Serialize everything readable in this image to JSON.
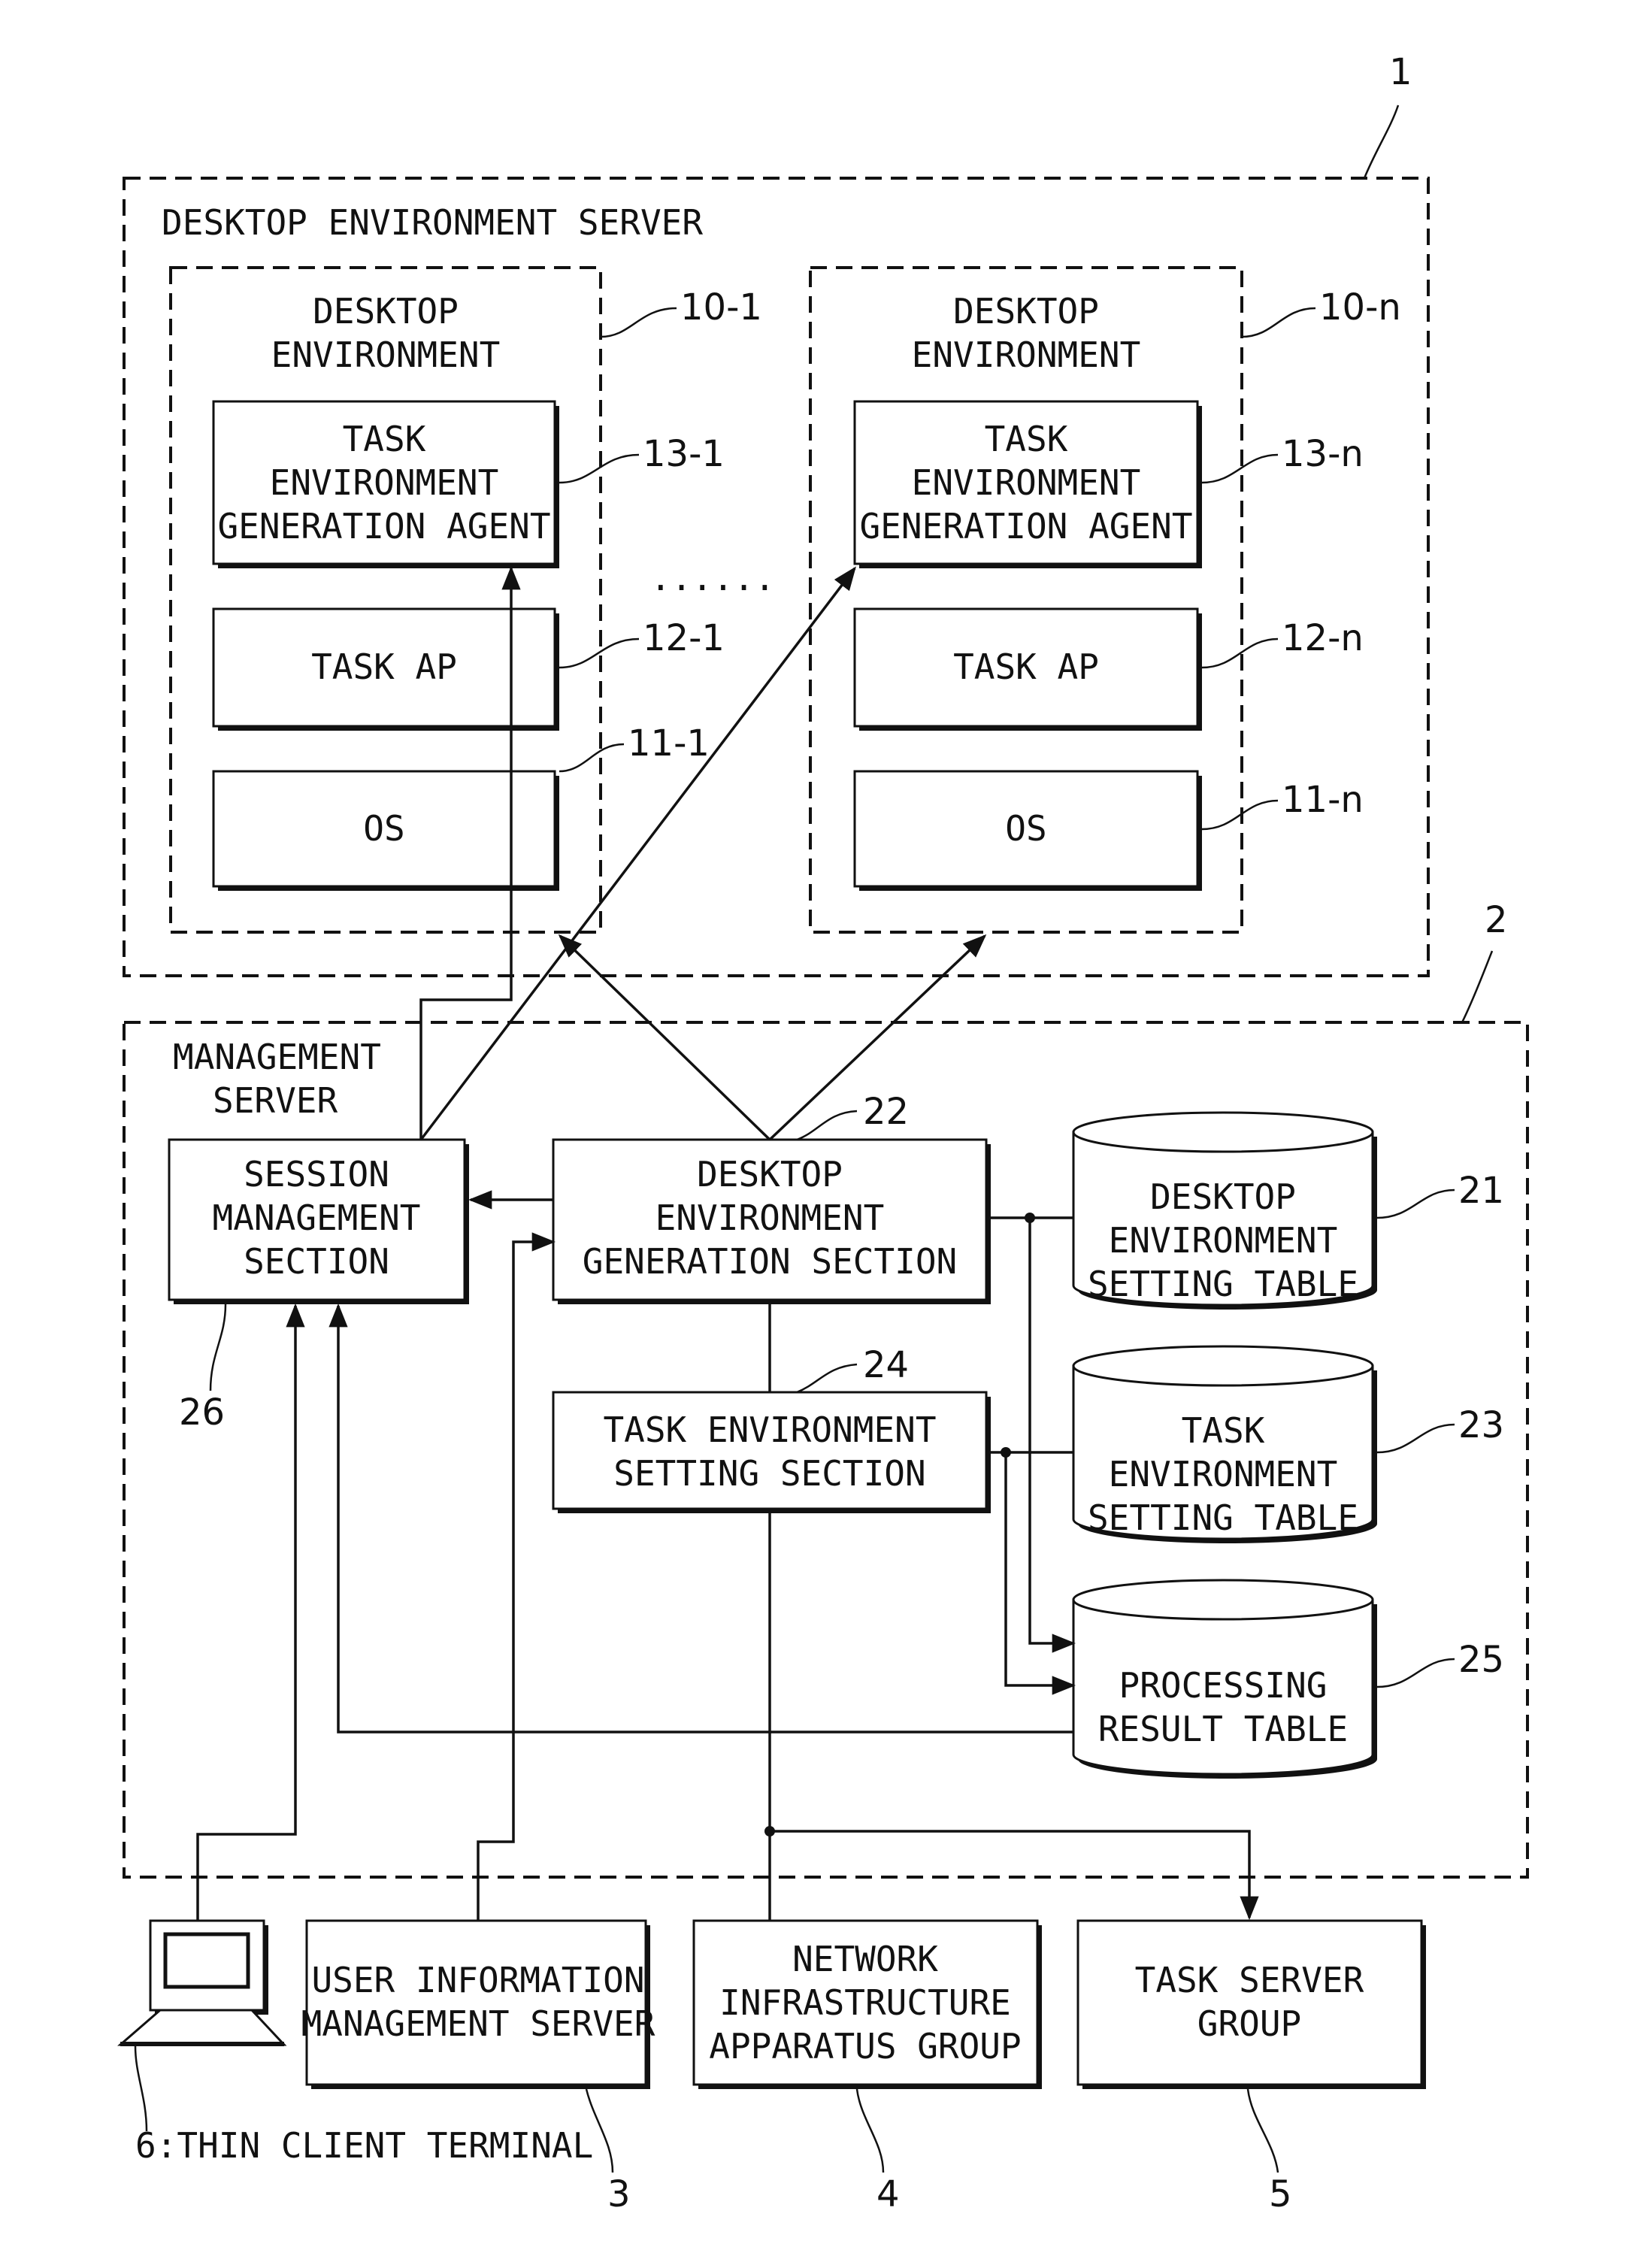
{
  "diagram": {
    "desktop_environment_server": {
      "title": "DESKTOP ENVIRONMENT SERVER",
      "ref": "1"
    },
    "desktop_environments": [
      {
        "title_line1": "DESKTOP",
        "title_line2": "ENVIRONMENT",
        "ref": "10-1",
        "agent": {
          "line1": "TASK",
          "line2": "ENVIRONMENT",
          "line3": "GENERATION AGENT",
          "ref": "13-1"
        },
        "task_ap": {
          "label": "TASK AP",
          "ref": "12-1"
        },
        "os": {
          "label": "OS",
          "ref": "11-1"
        }
      },
      {
        "title_line1": "DESKTOP",
        "title_line2": "ENVIRONMENT",
        "ref": "10-n",
        "agent": {
          "line1": "TASK",
          "line2": "ENVIRONMENT",
          "line3": "GENERATION AGENT",
          "ref": "13-n"
        },
        "task_ap": {
          "label": "TASK AP",
          "ref": "12-n"
        },
        "os": {
          "label": "OS",
          "ref": "11-n"
        }
      }
    ],
    "ellipsis": "......",
    "management_server": {
      "title_line1": "MANAGEMENT",
      "title_line2": "SERVER",
      "ref": "2",
      "session_management": {
        "line1": "SESSION",
        "line2": "MANAGEMENT",
        "line3": "SECTION",
        "ref": "26"
      },
      "desktop_env_generation": {
        "line1": "DESKTOP",
        "line2": "ENVIRONMENT",
        "line3": "GENERATION SECTION",
        "ref": "22"
      },
      "task_env_setting": {
        "line1": "TASK ENVIRONMENT",
        "line2": "SETTING SECTION",
        "ref": "24"
      },
      "desktop_env_setting_table": {
        "line1": "DESKTOP",
        "line2": "ENVIRONMENT",
        "line3": "SETTING TABLE",
        "ref": "21"
      },
      "task_env_setting_table": {
        "line1": "TASK",
        "line2": "ENVIRONMENT",
        "line3": "SETTING TABLE",
        "ref": "23"
      },
      "processing_result_table": {
        "line1": "PROCESSING",
        "line2": "RESULT TABLE",
        "ref": "25"
      }
    },
    "external": {
      "thin_client": {
        "label": "6:THIN CLIENT TERMINAL",
        "icon": "computer-terminal-icon"
      },
      "user_info_server": {
        "line1": "USER INFORMATION",
        "line2": "MANAGEMENT SERVER",
        "ref": "3"
      },
      "network_infra": {
        "line1": "NETWORK",
        "line2": "INFRASTRUCTURE",
        "line3": "APPARATUS GROUP",
        "ref": "4"
      },
      "task_server_group": {
        "line1": "TASK SERVER",
        "line2": "GROUP",
        "ref": "5"
      }
    }
  }
}
